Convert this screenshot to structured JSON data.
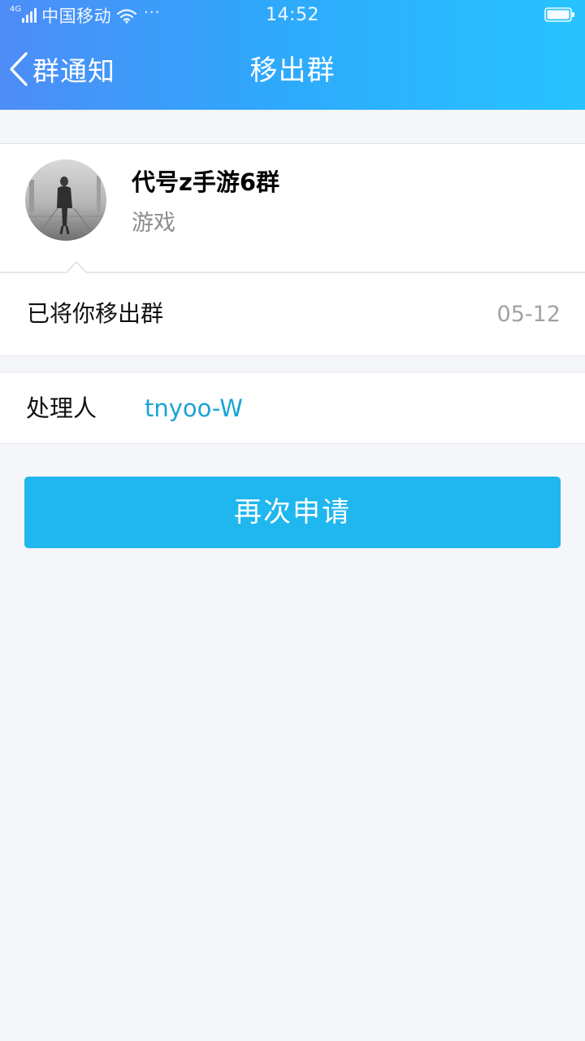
{
  "status_bar": {
    "network": "4G",
    "carrier": "中国移动",
    "more": "···",
    "time": "14:52"
  },
  "nav": {
    "back_label": "群通知",
    "title": "移出群"
  },
  "group": {
    "name": "代号z手游6群",
    "category": "游戏"
  },
  "notice": {
    "text": "已将你移出群",
    "date": "05-12"
  },
  "handler": {
    "label": "处理人",
    "name": "tnyoo-W"
  },
  "actions": {
    "reapply_label": "再次申请"
  },
  "colors": {
    "header_gradient_start": "#4e8cf7",
    "header_gradient_end": "#27c3ff",
    "primary_button": "#1fb7ee",
    "link_text": "#1ba3d6",
    "page_background": "#f5f6f9"
  },
  "icons": {
    "back": "chevron-left-icon",
    "wifi": "wifi-icon",
    "battery": "battery-icon",
    "signal": "signal-icon"
  }
}
